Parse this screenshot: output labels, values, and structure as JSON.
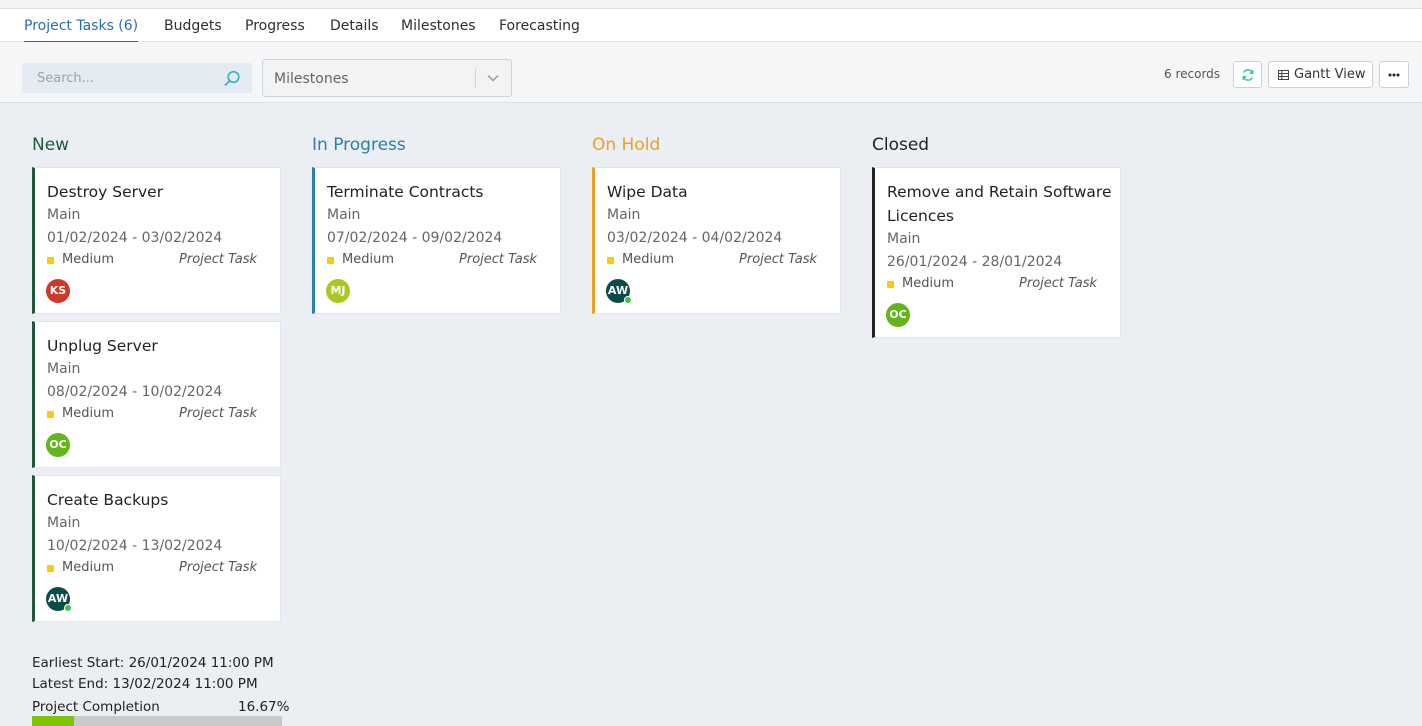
{
  "tabs": [
    {
      "label": "Project Tasks (6)",
      "active": true
    },
    {
      "label": "Budgets"
    },
    {
      "label": "Progress"
    },
    {
      "label": "Details"
    },
    {
      "label": "Milestones"
    },
    {
      "label": "Forecasting"
    }
  ],
  "toolbar": {
    "search_placeholder": "Search...",
    "milestones_select": "Milestones",
    "records": "6 records",
    "gantt_label": "Gantt View",
    "icons": [
      "search-icon",
      "chevron-down-icon",
      "refresh-icon",
      "table-icon",
      "more-icon"
    ]
  },
  "columns": [
    {
      "label": "New",
      "color": "#1e5a3a"
    },
    {
      "label": "In Progress",
      "color": "#2a7fa8"
    },
    {
      "label": "On Hold",
      "color": "#f0a020"
    },
    {
      "label": "Closed",
      "color": "#222222"
    }
  ],
  "cards": [
    {
      "title": "Destroy Server",
      "milestone": "Main",
      "dates": "01/02/2024 - 03/02/2024",
      "priority": "Medium",
      "type": "Project Task",
      "assignee": "KS",
      "avatar_color": "#d0382a",
      "online": false
    },
    {
      "title": "Unplug Server",
      "milestone": "Main",
      "dates": "08/02/2024 - 10/02/2024",
      "priority": "Medium",
      "type": "Project Task",
      "assignee": "OC",
      "avatar_color": "#62b51a",
      "online": false
    },
    {
      "title": "Create Backups",
      "milestone": "Main",
      "dates": "10/02/2024 - 13/02/2024",
      "priority": "Medium",
      "type": "Project Task",
      "assignee": "AW",
      "avatar_color": "#0d4a4a",
      "online": true
    },
    {
      "title": "Terminate Contracts",
      "milestone": "Main",
      "dates": "07/02/2024 - 09/02/2024",
      "priority": "Medium",
      "type": "Project Task",
      "assignee": "MJ",
      "avatar_color": "#a9c820",
      "online": false
    },
    {
      "title": "Wipe Data",
      "milestone": "Main",
      "dates": "03/02/2024 - 04/02/2024",
      "priority": "Medium",
      "type": "Project Task",
      "assignee": "AW",
      "avatar_color": "#0d4a4a",
      "online": true
    },
    {
      "title": "Remove and Retain Software Licences",
      "milestone": "Main",
      "dates": "26/01/2024 - 28/01/2024",
      "priority": "Medium",
      "type": "Project Task",
      "assignee": "OC",
      "avatar_color": "#62b51a",
      "online": false
    }
  ],
  "priority_color": "#f5d000",
  "summary": {
    "earliest_start": "Earliest Start: 26/01/2024 11:00 PM",
    "latest_end": "Latest End: 13/02/2024 11:00 PM",
    "completion_label": "Project Completion",
    "completion_text": "16.67%",
    "completion_value": 16.67
  }
}
